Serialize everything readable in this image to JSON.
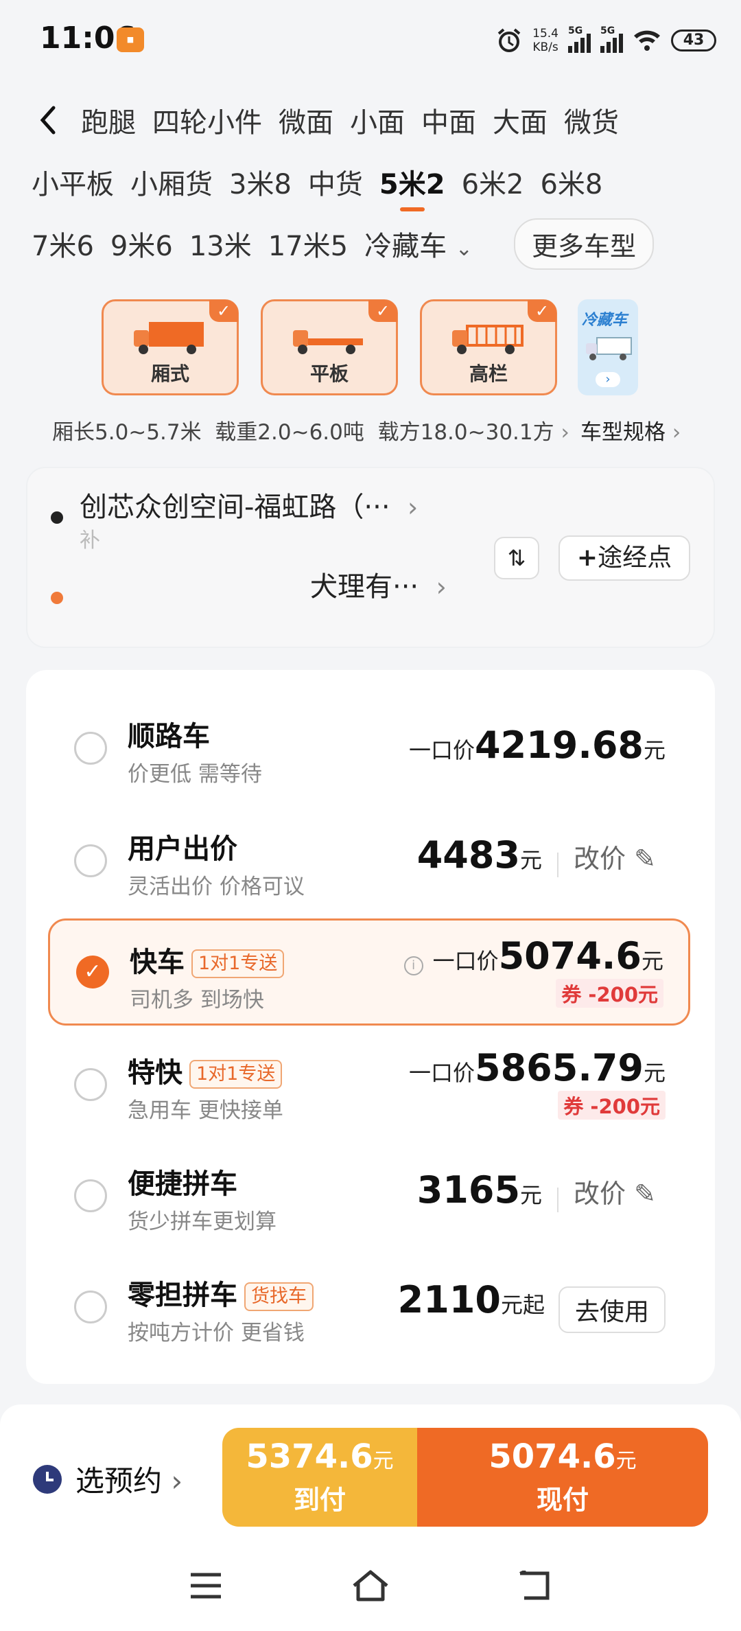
{
  "status_bar": {
    "time": "11:06",
    "net_speed": "15.4",
    "net_unit": "KB/s",
    "sim1": "5G",
    "sim2": "5G",
    "battery": "43"
  },
  "vehicle_tabs": {
    "row1": [
      "跑腿",
      "四轮小件",
      "微面",
      "小面",
      "中面",
      "大面",
      "微货"
    ],
    "row2": [
      "小平板",
      "小厢货",
      "3米8",
      "中货",
      "5米2",
      "6米2",
      "6米8"
    ],
    "row3": [
      "7米6",
      "9米6",
      "13米",
      "17米5",
      "冷藏车"
    ],
    "active": "5米2",
    "more_label": "更多车型"
  },
  "cargo_types": [
    {
      "label": "厢式",
      "selected": true
    },
    {
      "label": "平板",
      "selected": true
    },
    {
      "label": "高栏",
      "selected": true
    }
  ],
  "cold_card_label": "冷藏车",
  "spec": {
    "length": "厢长5.0~5.7米",
    "load": "载重2.0~6.0吨",
    "volume": "载方18.0~30.1方",
    "link": "车型规格"
  },
  "address": {
    "from": "创芯众创空间-福虹路（···",
    "from_sub": "补",
    "to": "犬理有···",
    "via_label": "途经点"
  },
  "options": [
    {
      "name": "顺路车",
      "tag": "",
      "sub": "价更低 需等待",
      "price_label": "一口价",
      "price": "4219.68",
      "unit": "元",
      "coupon": "",
      "action": ""
    },
    {
      "name": "用户出价",
      "tag": "",
      "sub": "灵活出价 价格可议",
      "price_label": "",
      "price": "4483",
      "unit": "元",
      "coupon": "",
      "action": "改价"
    },
    {
      "name": "快车",
      "tag": "1对1专送",
      "sub": "司机多 到场快",
      "price_label": "一口价",
      "price": "5074.6",
      "unit": "元",
      "coupon": "券 -200元",
      "action": "",
      "selected": true
    },
    {
      "name": "特快",
      "tag": "1对1专送",
      "sub": "急用车 更快接单",
      "price_label": "一口价",
      "price": "5865.79",
      "unit": "元",
      "coupon": "券 -200元",
      "action": ""
    },
    {
      "name": "便捷拼车",
      "tag": "",
      "sub": "货少拼车更划算",
      "price_label": "",
      "price": "3165",
      "unit": "元",
      "coupon": "",
      "action": "改价"
    },
    {
      "name": "零担拼车",
      "tag": "货找车",
      "sub": "按吨方计价 更省钱",
      "price_label": "",
      "price": "2110",
      "unit": "元起",
      "coupon": "",
      "action": "去使用"
    }
  ],
  "bottom": {
    "book_label": "选预约",
    "pay_on_arrival": {
      "amount": "5374.6",
      "unit": "元",
      "label": "到付"
    },
    "pay_now": {
      "amount": "5074.6",
      "unit": "元",
      "label": "现付"
    }
  },
  "colors": {
    "accent": "#ef6a25",
    "yellow": "#f4b73a",
    "coupon_red": "#e03a3a"
  }
}
